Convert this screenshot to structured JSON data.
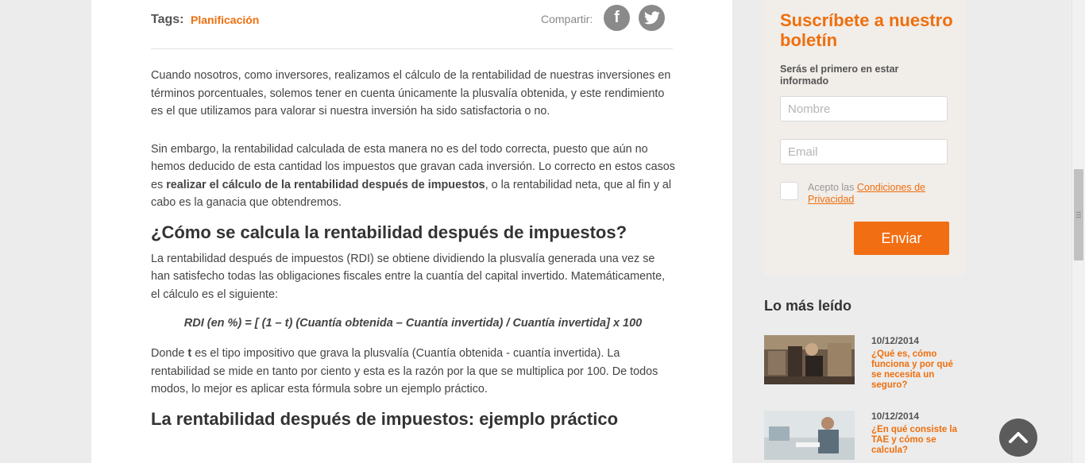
{
  "article": {
    "tags_label": "Tags:",
    "tag": "Planificación",
    "share_label": "Compartir:",
    "social": {
      "facebook": "f",
      "twitter": "twitter-icon"
    },
    "p1": "Cuando nosotros, como inversores, realizamos el cálculo de la rentabilidad de nuestras inversiones en términos porcentuales, solemos tener en cuenta únicamente la plusvalía obtenida, y este rendimiento es el que utilizamos para valorar si nuestra inversión ha sido satisfactoria o no.",
    "p2_before": "Sin embargo, la rentabilidad calculada de esta manera no es del todo correcta, puesto que aún no hemos deducido de esta cantidad los impuestos que gravan cada inversión. Lo correcto en estos casos es ",
    "p2_bold": "realizar el cálculo de la rentabilidad después de impuestos",
    "p2_after": ", o la rentabilidad neta, que al fin y al cabo es la ganacia que obtendremos.",
    "h2_1": "¿Cómo se calcula la rentabilidad después de impuestos?",
    "p3": "La rentabilidad después de impuestos (RDI) se obtiene dividiendo la plusvalía generada una vez se han satisfecho todas las obligaciones fiscales entre la cuantía del capital invertido. Matemáticamente, el cálculo es el siguiente:",
    "formula": "RDI (en %) = [ (1 – t) (Cuantía obtenida – Cuantía invertida)  / Cuantía invertida] x 100",
    "p4_before": "Donde ",
    "p4_bold": "t",
    "p4_after": " es el tipo impositivo que grava la plusvalía (Cuantía obtenida - cuantía invertida). La rentabilidad se mide en tanto por ciento y esta es la razón por la que se multiplica por 100. De todos modos, lo mejor es aplicar esta fórmula sobre un ejemplo práctico.",
    "h2_2": "La rentabilidad después de impuestos: ejemplo práctico"
  },
  "newsletter": {
    "title": "Suscríbete a nuestro boletín",
    "subtitle": "Serás el primero en estar informado",
    "name_placeholder": "Nombre",
    "email_placeholder": "Email",
    "accept_prefix": "Acepto las ",
    "accept_link": "Condiciones de Privacidad",
    "submit": "Enviar"
  },
  "popular": {
    "title": "Lo más leído",
    "items": [
      {
        "date": "10/12/2014",
        "title": "¿Qué es, cómo funciona y por qué se necesita un seguro?"
      },
      {
        "date": "10/12/2014",
        "title": "¿En qué consiste la TAE y cómo se calcula?"
      }
    ]
  },
  "colors": {
    "accent": "#ee6f0e",
    "button": "#f26e13",
    "sidebar_bg": "#f1ede9"
  }
}
